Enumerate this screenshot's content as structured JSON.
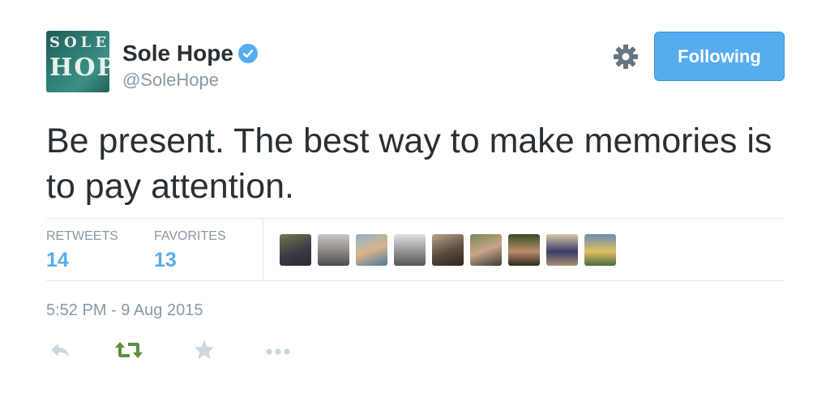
{
  "profile": {
    "name": "Sole Hope",
    "handle": "@SoleHope",
    "avatar_text_top": "SOLE",
    "avatar_text_bottom": "HOPE"
  },
  "follow_button": {
    "label": "Following"
  },
  "tweet": {
    "text": "Be present. The best way to make memories is to pay attention.",
    "timestamp": "5:52 PM - 9 Aug 2015"
  },
  "stats": {
    "retweets_label": "RETWEETS",
    "retweets_value": "14",
    "favorites_label": "FAVORITES",
    "favorites_value": "13"
  },
  "icons": {
    "verified": "verified-badge-icon",
    "settings": "gear-icon",
    "reply": "reply-icon",
    "retweet": "retweet-icon",
    "favorite": "star-icon",
    "more": "more-icon"
  },
  "colors": {
    "accent": "#55acee",
    "retweet_active": "#5c913b",
    "muted": "#8899a6",
    "text": "#292f33"
  },
  "favoriters_count_shown": 9
}
